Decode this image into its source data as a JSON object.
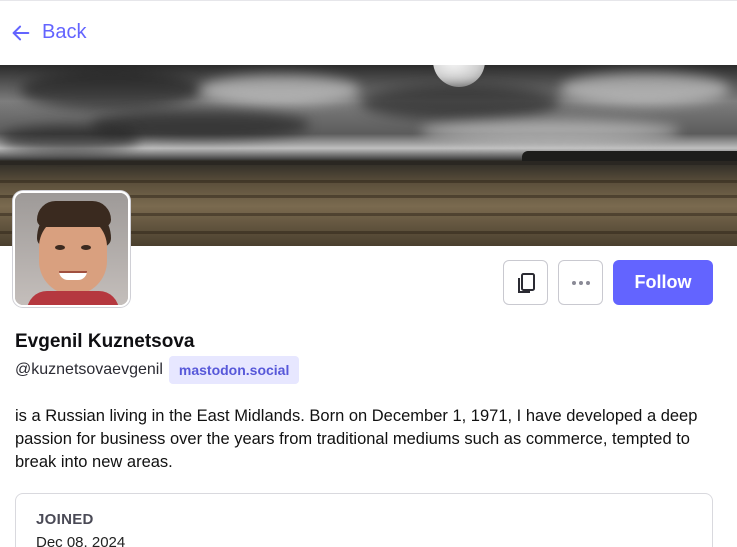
{
  "nav": {
    "back_label": "Back",
    "back_icon": "arrow-left-icon"
  },
  "profile": {
    "display_name": "Evgenil Kuznetsova",
    "handle": "@kuznetsovaevgenil",
    "domain": "mastodon.social",
    "bio": "is a Russian living in the East Midlands. Born on December 1, 1971, I have developed a deep passion for business over the years from traditional mediums such as commerce, tempted to break into new areas."
  },
  "actions": {
    "copy_icon": "copy-icon",
    "more_icon": "more-horizontal-icon",
    "follow_label": "Follow"
  },
  "joined": {
    "label": "JOINED",
    "date": "Dec 08, 2024"
  },
  "colors": {
    "accent": "#6364ff",
    "badge_bg": "#e7e7ff",
    "badge_text": "#5758d9"
  }
}
